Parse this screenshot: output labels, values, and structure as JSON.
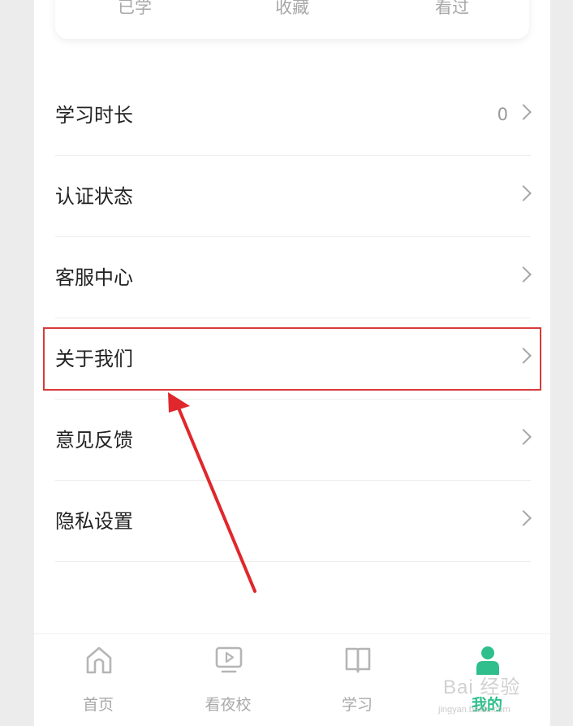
{
  "stats": {
    "items": [
      {
        "label": "已学"
      },
      {
        "label": "收藏"
      },
      {
        "label": "看过"
      }
    ]
  },
  "menu": {
    "items": [
      {
        "label": "学习时长",
        "value": "0"
      },
      {
        "label": "认证状态"
      },
      {
        "label": "客服中心"
      },
      {
        "label": "关于我们",
        "highlighted": true
      },
      {
        "label": "意见反馈"
      },
      {
        "label": "隐私设置"
      }
    ]
  },
  "annotation": {
    "highlight_color": "#d93a3a",
    "arrow_color": "#e0272c"
  },
  "tabbar": {
    "items": [
      {
        "label": "首页",
        "icon": "home-icon"
      },
      {
        "label": "看夜校",
        "icon": "video-icon"
      },
      {
        "label": "学习",
        "icon": "book-icon"
      },
      {
        "label": "我的",
        "icon": "profile-icon",
        "active": true
      }
    ],
    "active_color": "#2fbf8c",
    "inactive_color": "#a9a9a9"
  },
  "watermark": {
    "text": "Bai 经验",
    "sub": "jingyan.baidu.com"
  }
}
